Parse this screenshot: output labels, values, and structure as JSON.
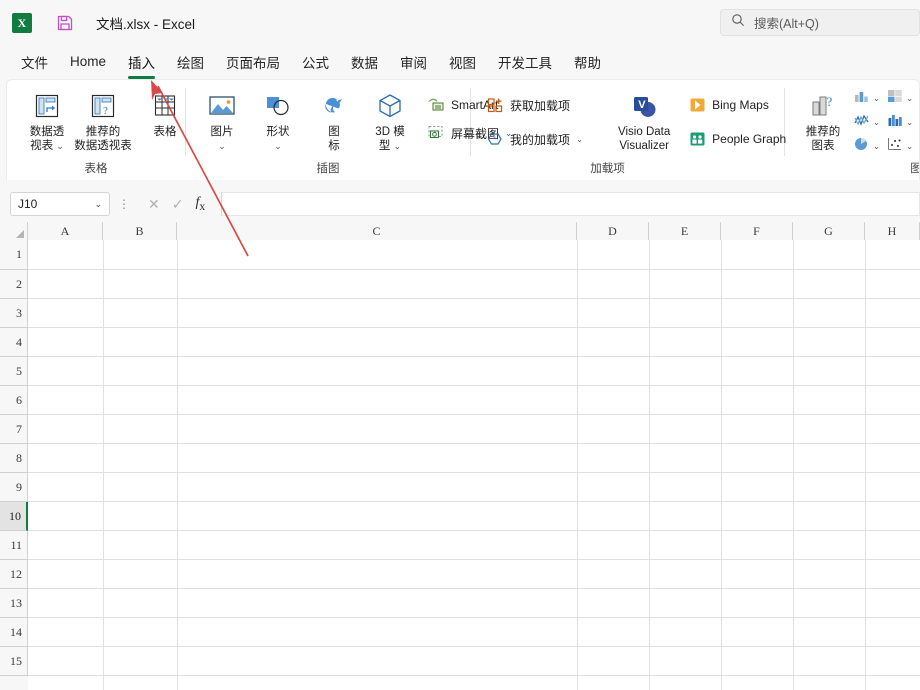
{
  "titlebar": {
    "app_icon": "excel-logo-icon",
    "save_icon": "save-icon",
    "document_title": "文档.xlsx  -  Excel",
    "logo_letter": "X"
  },
  "search": {
    "icon": "search-icon",
    "placeholder": "搜索(Alt+Q)"
  },
  "tabs": [
    {
      "label": "文件",
      "active": false
    },
    {
      "label": "Home",
      "active": false
    },
    {
      "label": "插入",
      "active": true
    },
    {
      "label": "绘图",
      "active": false
    },
    {
      "label": "页面布局",
      "active": false
    },
    {
      "label": "公式",
      "active": false
    },
    {
      "label": "数据",
      "active": false
    },
    {
      "label": "审阅",
      "active": false
    },
    {
      "label": "视图",
      "active": false
    },
    {
      "label": "开发工具",
      "active": false
    },
    {
      "label": "帮助",
      "active": false
    }
  ],
  "ribbon": {
    "groups": [
      {
        "name": "tables",
        "label": "表格",
        "items": [
          {
            "id": "pivot-table",
            "line1": "数据透",
            "line2": "视表",
            "dropdown": true,
            "icon": "pivot-table-icon"
          },
          {
            "id": "recommended-pivot-table",
            "line1": "推荐的",
            "line2": "数据透视表",
            "dropdown": false,
            "icon": "recommended-pivot-icon"
          },
          {
            "id": "table",
            "line1": "表格",
            "line2": "",
            "dropdown": false,
            "icon": "table-icon"
          }
        ]
      },
      {
        "name": "illustrations",
        "label": "插图",
        "items": [
          {
            "id": "pictures",
            "line1": "图片",
            "line2": "",
            "dropdown": true,
            "icon": "picture-icon"
          },
          {
            "id": "shapes",
            "line1": "形状",
            "line2": "",
            "dropdown": true,
            "icon": "shapes-icon"
          },
          {
            "id": "icons",
            "line1": "图",
            "line2": "标",
            "dropdown": false,
            "icon": "icons-icon"
          },
          {
            "id": "3d-models",
            "line1": "3D 模",
            "line2": "型",
            "dropdown": true,
            "icon": "3d-model-icon"
          }
        ],
        "small_items": [
          {
            "id": "smartart",
            "label": "SmartArt",
            "dropdown": false,
            "icon": "smartart-icon"
          },
          {
            "id": "screenshot",
            "label": "屏幕截图",
            "dropdown": true,
            "icon": "screenshot-icon"
          }
        ]
      },
      {
        "name": "addins",
        "label": "加载项",
        "small_items": [
          {
            "id": "get-addins",
            "label": "获取加载项",
            "dropdown": false,
            "icon": "get-addins-icon"
          },
          {
            "id": "my-addins",
            "label": "我的加载项",
            "dropdown": true,
            "icon": "my-addins-icon"
          }
        ],
        "big_items": [
          {
            "id": "visio-data-visualizer",
            "line1": "Visio Data",
            "line2": "Visualizer",
            "icon": "visio-icon"
          }
        ],
        "side_items": [
          {
            "id": "bing-maps",
            "label": "Bing Maps",
            "icon": "bing-maps-icon"
          },
          {
            "id": "people-graph",
            "label": "People Graph",
            "icon": "people-graph-icon"
          }
        ]
      },
      {
        "name": "charts",
        "label": "图表",
        "items": [
          {
            "id": "recommended-charts",
            "line1": "推荐的",
            "line2": "图表",
            "dropdown": false,
            "icon": "recommended-charts-icon"
          }
        ],
        "gallery": [
          [
            {
              "id": "column-bar-chart",
              "icon": "column-chart-icon"
            },
            {
              "id": "hierarchy-chart",
              "icon": "hierarchy-chart-icon"
            },
            {
              "id": "waterfall-chart",
              "icon": "waterfall-chart-icon"
            }
          ],
          [
            {
              "id": "line-chart",
              "icon": "line-chart-icon"
            },
            {
              "id": "statistic-chart",
              "icon": "statistic-chart-icon"
            },
            {
              "id": "combo-chart",
              "icon": "combo-chart-icon"
            }
          ],
          [
            {
              "id": "pie-chart",
              "icon": "pie-chart-icon"
            },
            {
              "id": "scatter-chart",
              "icon": "scatter-chart-icon"
            }
          ]
        ]
      }
    ]
  },
  "formula_bar": {
    "name_box_value": "J10",
    "name_box_chevron": "chevron-down-icon",
    "cancel_icon": "cancel-icon",
    "confirm_icon": "confirm-icon",
    "function_icon": "fx-icon",
    "formula_value": ""
  },
  "grid": {
    "columns": [
      "A",
      "B",
      "C",
      "D",
      "E",
      "F",
      "G",
      "H"
    ],
    "rows": [
      "1",
      "2",
      "3",
      "4",
      "5",
      "6",
      "7",
      "8",
      "9",
      "10",
      "11",
      "12",
      "13",
      "14",
      "15"
    ],
    "selected_cell": "J10",
    "selected_row": "10",
    "cell_values": []
  },
  "annotation": {
    "type": "arrow",
    "color": "#d94a4a",
    "points_to": "table-button"
  },
  "colors": {
    "accent": "#107c41",
    "titlebar_bg": "#f7f7f7",
    "ribbon_bg": "#ffffff",
    "annotation": "#d94a4a"
  }
}
